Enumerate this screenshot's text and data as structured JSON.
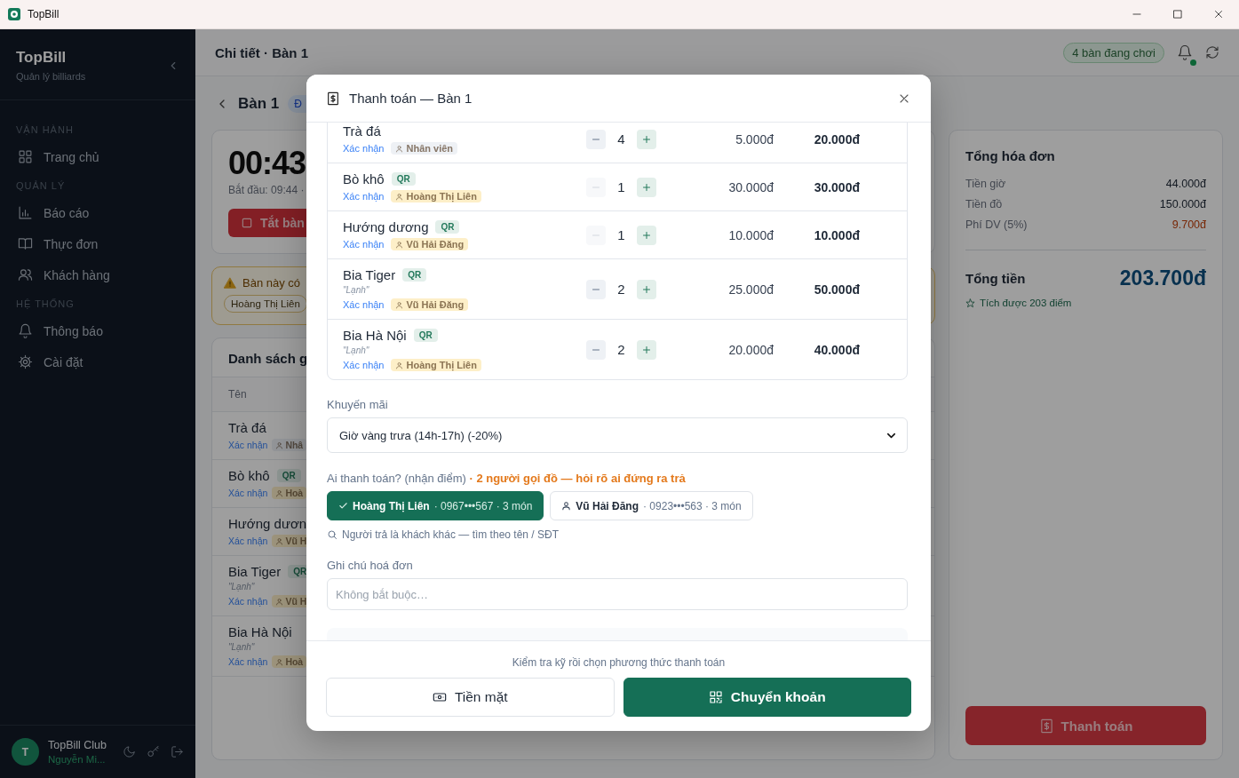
{
  "window": {
    "title": "TopBill"
  },
  "sidebar": {
    "brand": "TopBill",
    "subtitle": "Quản lý billiards",
    "sections": [
      {
        "heading": "VẬN HÀNH",
        "items": [
          {
            "label": "Trang chủ",
            "selected": false
          }
        ]
      },
      {
        "heading": "QUẢN LÝ",
        "items": [
          {
            "label": "Báo cáo",
            "selected": false
          },
          {
            "label": "Thực đơn",
            "selected": false
          },
          {
            "label": "Khách hàng",
            "selected": false
          }
        ]
      },
      {
        "heading": "HỆ THỐNG",
        "items": [
          {
            "label": "Thông báo",
            "selected": false
          },
          {
            "label": "Cài đặt",
            "selected": false
          }
        ]
      }
    ],
    "account": {
      "avatar": "T",
      "club": "TopBill Club",
      "user": "Nguyễn Mi..."
    }
  },
  "header": {
    "title": "Chi tiết · Bàn 1",
    "active_tables": "4 bàn đang chơi",
    "unread": true
  },
  "table_panel": {
    "name": "Bàn 1",
    "status_badge": "Đ",
    "timer": "00:43",
    "started": "Bắt đầu: 09:44 ·",
    "stop_button": "Tắt bàn",
    "warning": "Bàn này có",
    "warning_chip": "Hoàng Thị Liên",
    "orders_title": "Danh sách g",
    "column": "Tên",
    "orders": [
      {
        "name": "Trà đá",
        "confirm": "Xác nhận",
        "person": "Nhâ",
        "color": "#939598"
      },
      {
        "name": "Bò khô",
        "qr_badge": "QR",
        "confirm": "Xác nhận",
        "person": "Hoà",
        "color": "#9d947c"
      },
      {
        "name": "Hướng dươn",
        "confirm": "Xác nhận",
        "person": "Vũ H",
        "color": "#9d947c"
      },
      {
        "name": "Bia Tiger",
        "qr_badge": "QR",
        "note": "\"Lạnh\"",
        "confirm": "Xác nhận",
        "person": "Vũ H",
        "color": "#9d947c"
      },
      {
        "name": "Bia Hà Nội",
        "note": "\"Lạnh\"",
        "confirm": "Xác nhận",
        "person": "Hoà",
        "color": "#9d947c"
      }
    ]
  },
  "summary": {
    "title": "Tổng hóa đơn",
    "lines": [
      {
        "label": "Tiền giờ",
        "value": "44.000đ",
        "kind": "plain"
      },
      {
        "label": "Tiền đồ",
        "value": "150.000đ",
        "kind": "plain"
      },
      {
        "label": "Phí DV (5%)",
        "value": "9.700đ",
        "kind": "fee"
      }
    ],
    "total_label": "Tổng tiền",
    "total": "203.700đ",
    "points": "Tích được 203 điểm",
    "pay_button": "Thanh toán"
  },
  "modal": {
    "title": "Thanh toán — Bàn 1",
    "items": [
      {
        "name": "Trà đá",
        "confirm": "Xác nhận",
        "person": "Nhân viên",
        "color": "#eef1f5",
        "minus_disabled": false,
        "qty": "4",
        "price": "5.000đ",
        "total": "20.000đ"
      },
      {
        "name": "Bò khô",
        "qr_badge": "QR",
        "confirm": "Xác nhận",
        "person": "Hoàng Thị Liên",
        "color": "#fdefc8",
        "minus_disabled": true,
        "qty": "1",
        "price": "30.000đ",
        "total": "30.000đ"
      },
      {
        "name": "Hướng dương",
        "qr_badge": "QR",
        "confirm": "Xác nhận",
        "person": "Vũ Hải Đăng",
        "color": "#fdefc8",
        "minus_disabled": true,
        "qty": "1",
        "price": "10.000đ",
        "total": "10.000đ"
      },
      {
        "name": "Bia Tiger",
        "qr_badge": "QR",
        "note": "\"Lạnh\"",
        "confirm": "Xác nhận",
        "person": "Vũ Hải Đăng",
        "color": "#fdefc8",
        "minus_disabled": false,
        "qty": "2",
        "price": "25.000đ",
        "total": "50.000đ"
      },
      {
        "name": "Bia Hà Nội",
        "qr_badge": "QR",
        "note": "\"Lạnh\"",
        "confirm": "Xác nhận",
        "person": "Hoàng Thị Liên",
        "color": "#fdefc8",
        "minus_disabled": false,
        "qty": "2",
        "price": "20.000đ",
        "total": "40.000đ"
      }
    ],
    "promo": {
      "label": "Khuyến mãi",
      "value": "Giờ vàng trưa (14h-17h) (-20%)"
    },
    "payer": {
      "label": "Ai thanh toán? (nhận điểm)",
      "warning": "· 2 người gọi đồ — hỏi rõ ai đứng ra trả",
      "options": [
        {
          "name": "Hoàng Thị Liên",
          "detail": "· 0967•••567 · 3 món",
          "selected": true
        },
        {
          "name": "Vũ Hải Đăng",
          "detail": "· 0923•••563 · 3 món",
          "selected": false
        }
      ],
      "search_hint": "Người trả là khách khác — tìm theo tên / SĐT"
    },
    "note": {
      "label": "Ghi chú hoá đơn",
      "placeholder": "Không bắt buộc…"
    },
    "footer": {
      "hint": "Kiểm tra kỹ rồi chọn phương thức thanh toán",
      "methods": [
        {
          "label": "Tiền mặt",
          "kind": "cash"
        },
        {
          "label": "Chuyển khoản",
          "kind": "transfer"
        }
      ]
    }
  }
}
